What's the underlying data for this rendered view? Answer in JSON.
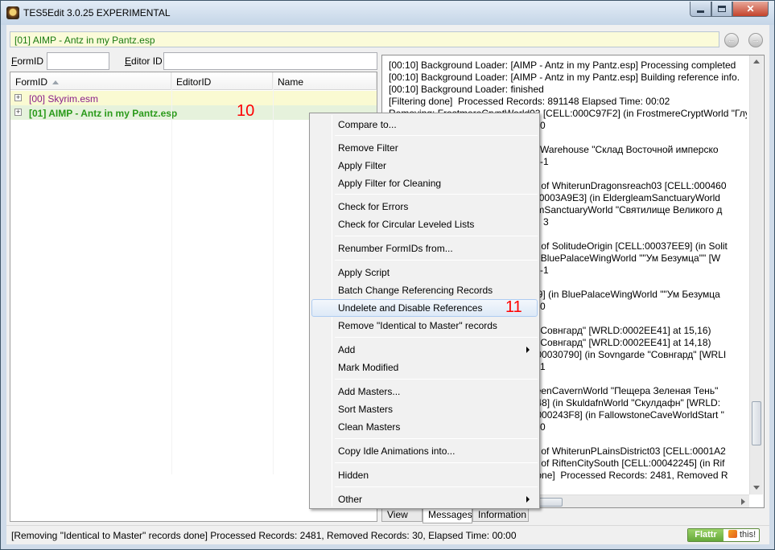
{
  "window": {
    "title": "TES5Edit 3.0.25 EXPERIMENTAL"
  },
  "path_bar": {
    "value": "[01] AIMP - Antz in my Pantz.esp"
  },
  "filters": {
    "formid_label_prefix": "F",
    "formid_label_rest": "ormID",
    "editorid_label_prefix": "E",
    "editorid_label_rest": "ditor ID",
    "formid_value": "",
    "editorid_value": ""
  },
  "tree": {
    "columns": [
      "FormID",
      "EditorID",
      "Name"
    ],
    "rows": [
      {
        "expander": "+",
        "label": "[00] Skyrim.esm"
      },
      {
        "expander": "+",
        "label": "[01] AIMP - Antz in my Pantz.esp"
      }
    ]
  },
  "annotations": {
    "a10": "10",
    "a11": "11"
  },
  "log_lines": [
    "[00:10] Background Loader: [AIMP - Antz in my Pantz.esp] Processing completed",
    "[00:10] Background Loader: [AIMP - Antz in my Pantz.esp] Building reference info.",
    "[00:10] Background Loader: finished",
    "[Filtering done]  Processed Records: 891148 Elapsed Time: 00:02",
    "Removing: FrostmereCryptWorld03 [CELL:000C97F2] (in FrostmereCryptWorld \"Глуб",
    "                                             lock 0, 0",
    "                                             0, 0",
    "                                             EmpireWarehouse \"Склад Восточной имперско",
    "                                             lock 0, -1",
    "                                             0, -1",
    "                                             hildren of WhiterunDragonsreach03 [CELL:000460",
    "                                             [CELL:0003A9E3] (in EldergleamSanctuaryWorld",
    "                                             ergleamSanctuaryWorld \"Святилище Великого д",
    "                                             lock -1, 3",
    "                                             -1, 0",
    "                                             hildren of SolitudeOrigin [CELL:00037EE9] (in Solit",
    "                                             3D] (in BluePalaceWingWorld \"\"Ум Безумца\"\" [W",
    "                                             lock 0, -1",
    "                                             0, -1",
    "                                             09B239] (in BluePalaceWingWorld \"\"Ум Безумца",
    "                                             lock 0, 0",
    "                                             0, 0",
    "                                             garde \"Совнгард\" [WRLD:0002EE41] at 15,16)",
    "                                             garde \"Совнгард\" [WRLD:0002EE41] at 14,18)",
    "                                             CELL:00030790] (in Sovngarde \"Совнгард\" [WRLI",
    "                                             lock 2, 1",
    "                                             2, 1",
    "                                             dowgreenCavernWorld \"Пещера Зеленая Тень\"",
    "                                             0027948] (in SkuldafnWorld \"Скулдафн\" [WRLD:",
    "                                             CELL:000243F8] (in FallowstoneCaveWorldStart \"",
    "                                             lock 0, 0",
    "                                             0, 0",
    "                                             hildren of WhiterunPLainsDistrict03 [CELL:0001A2",
    "                                             hildren of RiftenCitySouth [CELL:00042245] (in Rif",
    "                                             ords done]  Processed Records: 2481, Removed R"
  ],
  "tabs": {
    "view": "View",
    "messages": "Messages",
    "information": "Information"
  },
  "status": {
    "text": "[Removing \"Identical to Master\" records done]  Processed Records: 2481, Removed Records: 30, Elapsed Time: 00:00"
  },
  "flattr": {
    "left": "Flattr",
    "right": "this!"
  },
  "context_menu": {
    "items": [
      "Compare to...",
      "Remove Filter",
      "Apply Filter",
      "Apply Filter for Cleaning",
      "Check for Errors",
      "Check for Circular Leveled Lists",
      "Renumber FormIDs from...",
      "Apply Script",
      "Batch Change Referencing Records",
      "Undelete and Disable References",
      "Remove \"Identical to Master\" records",
      "Add",
      "Mark Modified",
      "Add Masters...",
      "Sort Masters",
      "Clean Masters",
      "Copy Idle Animations into...",
      "Hidden",
      "Other"
    ]
  },
  "colors": {
    "path_bar_text": "#1a7a10",
    "esm_text": "#8a1f8a",
    "esp_text": "#2a9a1a",
    "annotation": "#ff0000",
    "menu_highlight": "#dde9f7"
  }
}
